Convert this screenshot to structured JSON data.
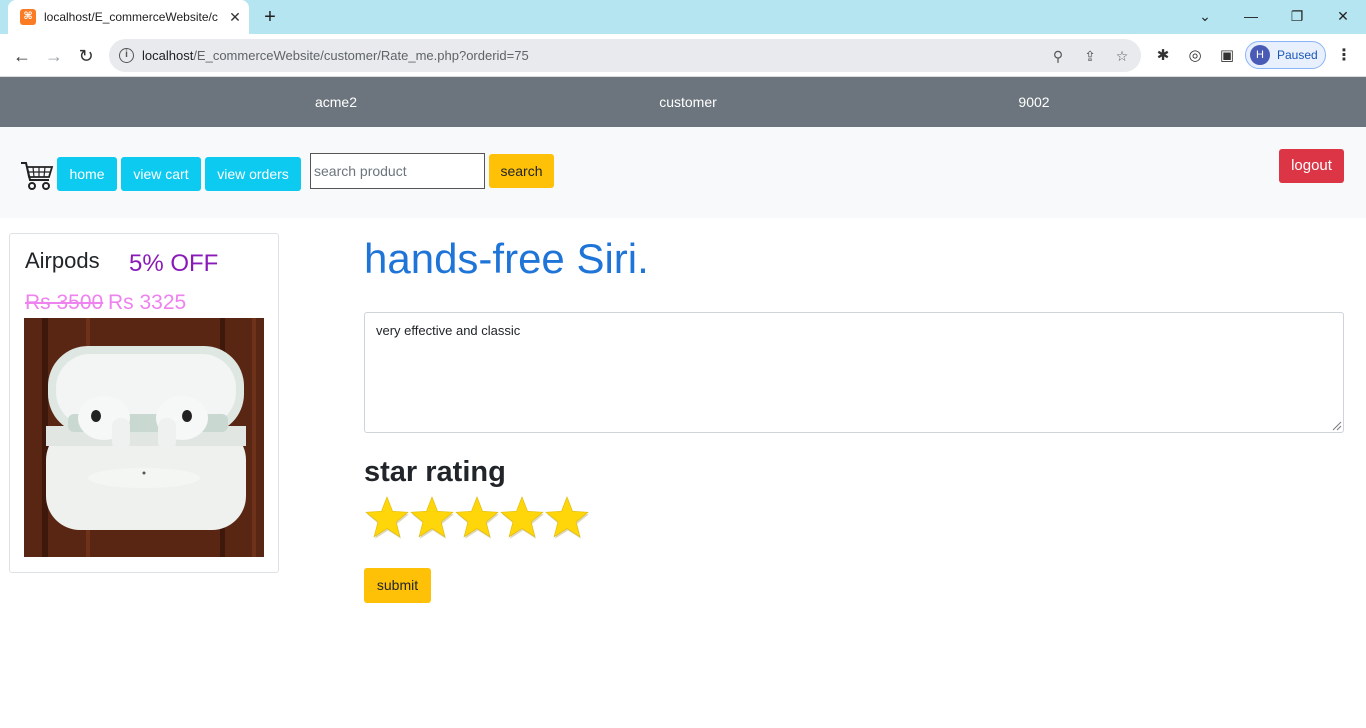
{
  "browser": {
    "tab_title": "localhost/E_commerceWebsite/c",
    "tab_favicon_glyph": "⌘",
    "url_host": "localhost",
    "url_path": "/E_commerceWebsite/customer/Rate_me.php?orderid=75",
    "profile_initial": "H",
    "profile_status": "Paused"
  },
  "infobar": {
    "store_name": "acme2",
    "role": "customer",
    "user_id": "9002"
  },
  "navbar": {
    "home_label": "home",
    "view_cart_label": "view cart",
    "view_orders_label": "view orders",
    "search_placeholder": "search product",
    "search_label": "search",
    "logout_label": "logout"
  },
  "product": {
    "name": "Airpods",
    "discount": "5% OFF",
    "old_price": "Rs 3500",
    "new_price": "Rs 3325"
  },
  "review": {
    "heading": "hands-free Siri.",
    "text": "very effective and classic",
    "rating_heading": "star rating",
    "rating": 5,
    "rating_max": 5,
    "submit_label": "submit"
  },
  "colors": {
    "infobar_bg": "#6c757d",
    "info_button": "#0dcaf0",
    "warning_button": "#ffc107",
    "danger_button": "#dc3545",
    "heading_blue": "#1f74d8",
    "discount_purple": "#8a1ab8",
    "price_pink": "#ee82ee",
    "star_gold": "#ffd60a"
  }
}
